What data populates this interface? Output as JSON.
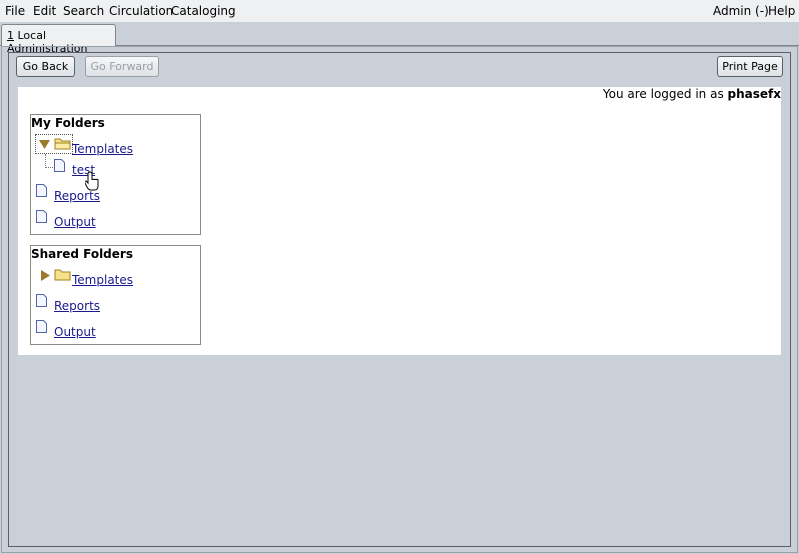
{
  "menubar": {
    "file": "File",
    "edit": "Edit",
    "search": "Search",
    "circulation": "Circulation",
    "cataloging": "Cataloging",
    "admin": "Admin (-)",
    "help": "Help"
  },
  "tabs": [
    {
      "number": "1",
      "label": " Local Administration"
    }
  ],
  "toolbar": {
    "go_back": "Go Back",
    "go_forward": "Go Forward",
    "print_page": "Print Page"
  },
  "login": {
    "prefix": "You are logged in as ",
    "user": "phasefx"
  },
  "my_folders": {
    "title": "My Folders",
    "templates": "Templates",
    "templates_child": "test",
    "reports": "Reports",
    "output": "Output"
  },
  "shared_folders": {
    "title": "Shared Folders",
    "templates": "Templates",
    "reports": "Reports",
    "output": "Output"
  }
}
